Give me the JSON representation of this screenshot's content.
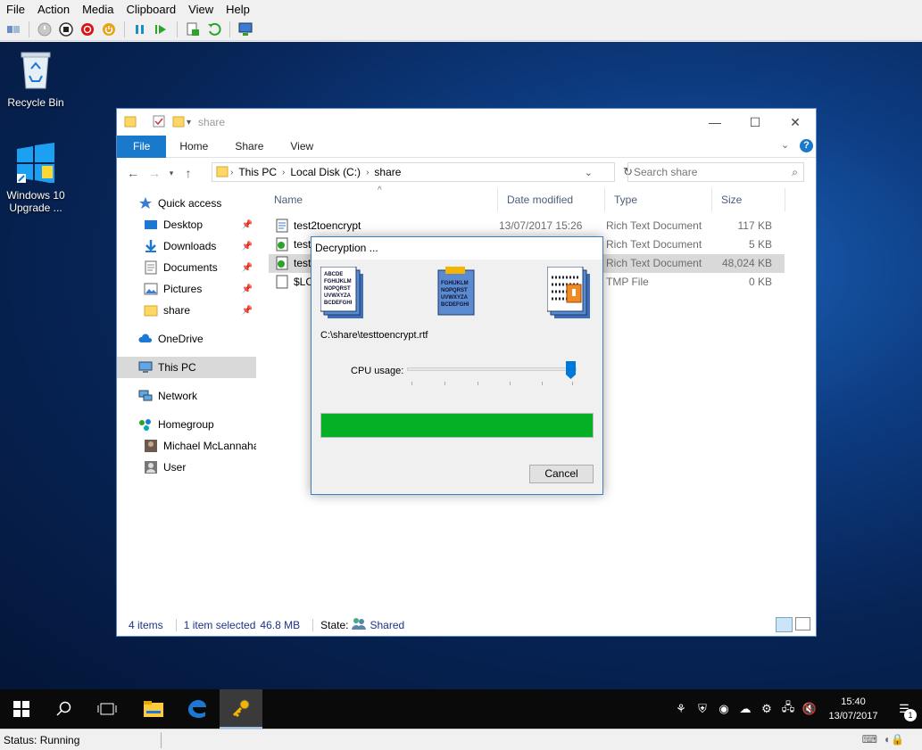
{
  "host": {
    "menu": [
      "File",
      "Action",
      "Media",
      "Clipboard",
      "View",
      "Help"
    ],
    "toolbar_icons": [
      "ctrl-alt-del-icon",
      "start-icon",
      "turn-off-icon",
      "shutdown-icon",
      "power-icon",
      "pause-icon",
      "resume-icon",
      "checkpoint-icon",
      "revert-icon",
      "enhanced-session-icon"
    ],
    "status": "Status: Running"
  },
  "desktop": {
    "icons": [
      {
        "label": "Recycle Bin"
      },
      {
        "label": "Windows 10 Upgrade ..."
      }
    ]
  },
  "explorer": {
    "title": "share",
    "tabs": [
      "File",
      "Home",
      "Share",
      "View"
    ],
    "breadcrumb": [
      "This PC",
      "Local Disk (C:)",
      "share"
    ],
    "search_placeholder": "Search share",
    "nav": [
      {
        "label": "Quick access",
        "icon": "star-icon"
      },
      {
        "label": "Desktop",
        "icon": "desktop-icon",
        "pinned": true
      },
      {
        "label": "Downloads",
        "icon": "download-icon",
        "pinned": true
      },
      {
        "label": "Documents",
        "icon": "documents-icon",
        "pinned": true
      },
      {
        "label": "Pictures",
        "icon": "pictures-icon",
        "pinned": true
      },
      {
        "label": "share",
        "icon": "folder-icon",
        "pinned": true
      },
      {
        "label": "OneDrive",
        "icon": "cloud-icon"
      },
      {
        "label": "This PC",
        "icon": "computer-icon",
        "selected": true
      },
      {
        "label": "Network",
        "icon": "network-icon"
      },
      {
        "label": "Homegroup",
        "icon": "homegroup-icon"
      },
      {
        "label": "Michael McLannaha",
        "icon": "user-photo-icon"
      },
      {
        "label": "User",
        "icon": "user-icon"
      }
    ],
    "columns": [
      "Name",
      "Date modified",
      "Type",
      "Size"
    ],
    "files": [
      {
        "name": "test2toencrypt",
        "date": "13/07/2017 15:26",
        "type": "Rich Text Document",
        "size": "117 KB"
      },
      {
        "name": "test",
        "date": "",
        "type": "Rich Text Document",
        "size": "5 KB"
      },
      {
        "name": "test",
        "date": "",
        "type": "Rich Text Document",
        "size": "48,024 KB",
        "selected": true
      },
      {
        "name": "$LC",
        "date": "",
        "type": "TMP File",
        "size": "0 KB"
      }
    ],
    "status": {
      "items": "4 items",
      "selected": "1 item selected",
      "size": "46.8 MB",
      "state_label": "State:",
      "state_value": "Shared"
    }
  },
  "dialog": {
    "title": "Decryption ...",
    "path": "C:\\share\\testtoencrypt.rtf",
    "cpu_label": "CPU usage:",
    "cpu_level": 1.0,
    "progress": 1.0,
    "cancel": "Cancel",
    "doc_lines": [
      "ABCDE",
      "FGHIJKLM",
      "NOPQRST",
      "UVWXYZA",
      "BCDEFGHI"
    ]
  },
  "taskbar": {
    "time": "15:40",
    "date": "13/07/2017",
    "notif_count": "1"
  }
}
